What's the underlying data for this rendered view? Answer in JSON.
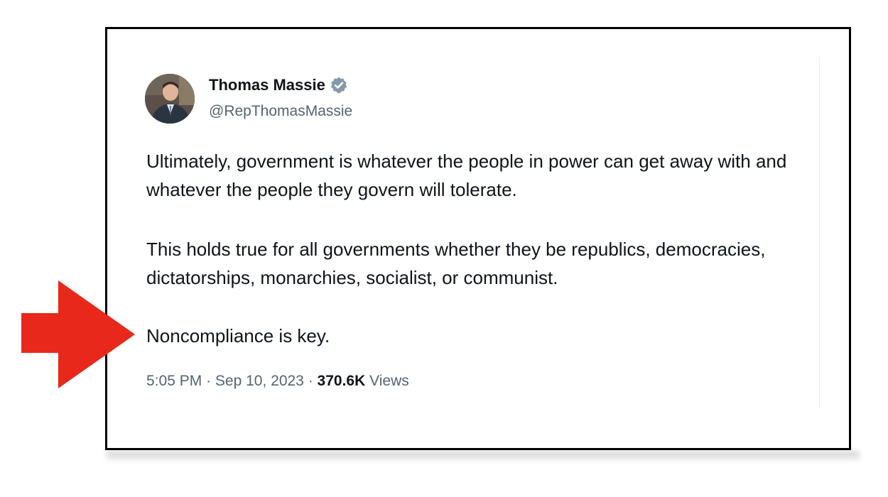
{
  "tweet": {
    "author_name": "Thomas Massie",
    "author_handle": "@RepThomasMassie",
    "verified": true,
    "paragraphs": [
      "Ultimately, government is whatever the people in power can get away with and whatever the people they govern will tolerate.",
      "This holds true for all governments whether they be republics, democracies, dictatorships, monarchies, socialist, or communist.",
      "Noncompliance is key."
    ],
    "time": "5:05 PM",
    "separator": "·",
    "date": "Sep 10, 2023",
    "views_count": "370.6K",
    "views_label": "Views"
  },
  "icons": {
    "avatar": "avatar-photo",
    "verified": "verified-badge-icon",
    "pointer": "red-arrow-icon"
  },
  "colors": {
    "arrow": "#e8281a",
    "text_primary": "#0f1419",
    "text_secondary": "#536471",
    "badge": "#829aab",
    "card_border": "#000000"
  }
}
